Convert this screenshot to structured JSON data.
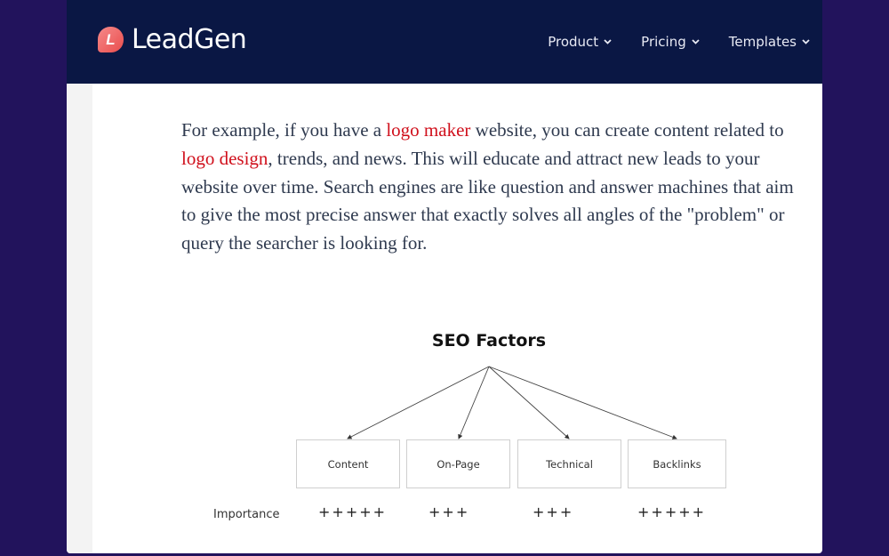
{
  "header": {
    "logo_letter": "L",
    "brand": "LeadGen",
    "nav": [
      {
        "label": "Product"
      },
      {
        "label": "Pricing"
      },
      {
        "label": "Templates"
      }
    ]
  },
  "article": {
    "p_part1": "For example, if you have a ",
    "link1": "logo maker",
    "p_part2": " website, you can create content related to ",
    "link2": "logo design",
    "p_part3": ", trends, and news. This will educate and attract new leads to your website over time. Search engines are like question and answer machines that aim to give the most precise answer that exactly solves all angles of the \"problem\" or query the searcher is looking for."
  },
  "diagram": {
    "title": "SEO Factors",
    "importance_label": "Importance",
    "factors": [
      {
        "label": "Content",
        "importance": "+++++"
      },
      {
        "label": "On-Page",
        "importance": "+++"
      },
      {
        "label": "Technical",
        "importance": "+++"
      },
      {
        "label": "Backlinks",
        "importance": "+++++"
      }
    ]
  }
}
